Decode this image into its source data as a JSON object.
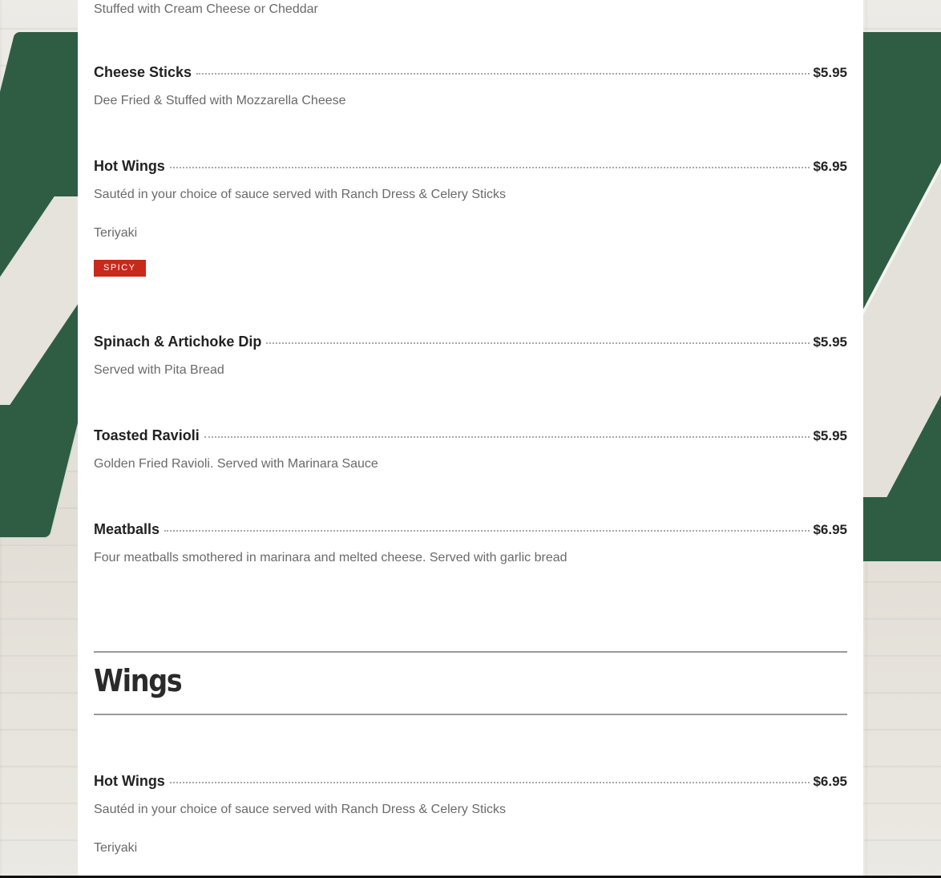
{
  "colors": {
    "badge_bg": "#c8291b",
    "panel_bg": "#ffffff",
    "backdrop_green": "#2f5d43"
  },
  "top_description": "Stuffed with Cream Cheese or Cheddar",
  "items": [
    {
      "name": "Cheese Sticks",
      "price": "$5.95",
      "description": "Dee Fried & Stuffed with Mozzarella Cheese"
    },
    {
      "name": "Hot Wings",
      "price": "$6.95",
      "description": "Sautéd in your choice of sauce served with Ranch Dress & Celery Sticks",
      "option": "Teriyaki",
      "badge": "SPICY"
    },
    {
      "name": "Spinach & Artichoke Dip",
      "price": "$5.95",
      "description": "Served with Pita Bread"
    },
    {
      "name": "Toasted Ravioli",
      "price": "$5.95",
      "description": "Golden Fried Ravioli. Served with Marinara Sauce"
    },
    {
      "name": "Meatballs",
      "price": "$6.95",
      "description": "Four meatballs smothered in marinara and melted cheese. Served with garlic bread"
    }
  ],
  "wings_section": {
    "title": "Wings",
    "items": [
      {
        "name": "Hot Wings",
        "price": "$6.95",
        "description": "Sautéd in your choice of sauce served with Ranch Dress & Celery Sticks",
        "option": "Teriyaki"
      }
    ]
  }
}
